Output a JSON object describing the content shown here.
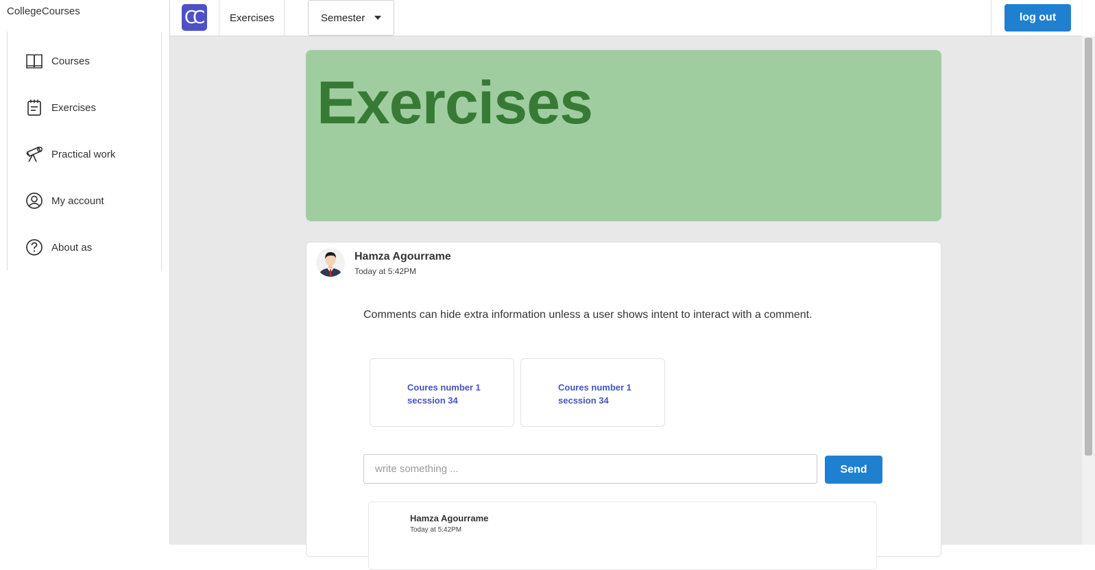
{
  "sidebar": {
    "brand": "CollegeCourses",
    "items": [
      {
        "label": "Courses",
        "icon": "open-book-icon"
      },
      {
        "label": "Exercises",
        "icon": "notepad-icon"
      },
      {
        "label": "Practical work",
        "icon": "telescope-icon"
      },
      {
        "label": "My account",
        "icon": "user-circle-icon"
      },
      {
        "label": "About as",
        "icon": "question-circle-icon"
      }
    ]
  },
  "topbar": {
    "logo_text": "CC",
    "nav_label": "Exercises",
    "semester_label": "Semester",
    "logout_label": "log out"
  },
  "hero": {
    "title": "Exercises"
  },
  "post": {
    "author": "Hamza Agourrame",
    "time": "Today at 5:42PM",
    "text": "Comments can hide extra information unless a user shows intent to interact with a comment.",
    "courses": [
      {
        "line1": "Coures number 1",
        "line2": "secssion 34"
      },
      {
        "line1": "Coures number 1",
        "line2": "secssion 34"
      }
    ],
    "input_placeholder": "write something ...",
    "send_label": "Send",
    "reply": {
      "author": "Hamza Agourrame",
      "time": "Today at 5:42PM"
    }
  },
  "colors": {
    "accent": "#2080d0",
    "logo_bg": "#4e51c6",
    "hero_bg": "#a0cd9f",
    "hero_text": "#377a35",
    "link": "#4154c4"
  }
}
